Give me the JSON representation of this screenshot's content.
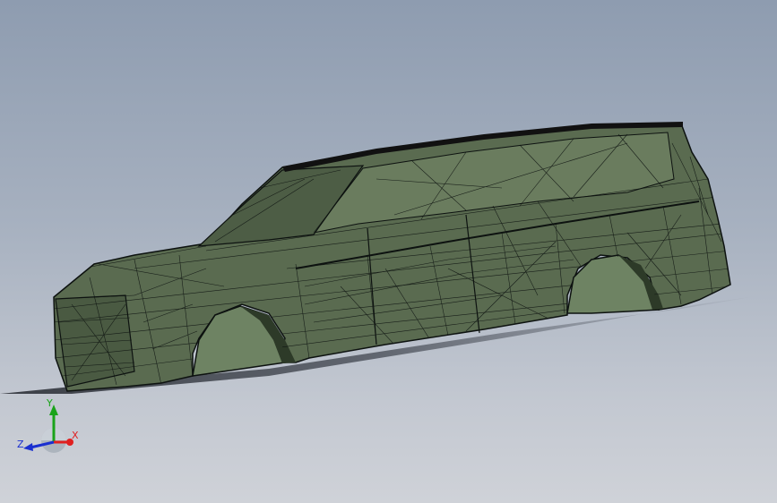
{
  "viewport": {
    "model": "suv-wireframe-mesh",
    "colors": {
      "background_top": "#8e9cb0",
      "background_bottom": "#cfd2d8",
      "body_fill": "#5a6b50",
      "body_fill_dark": "#4a5a42",
      "wheel_well": "#6e8363",
      "mesh_line": "#0d1210",
      "shadow": "#3a3f48"
    }
  },
  "triad": {
    "x_label": "X",
    "y_label": "Y",
    "z_label": "Z",
    "x_color": "#e02020",
    "y_color": "#1aa31a",
    "z_color": "#1a2fd0"
  }
}
